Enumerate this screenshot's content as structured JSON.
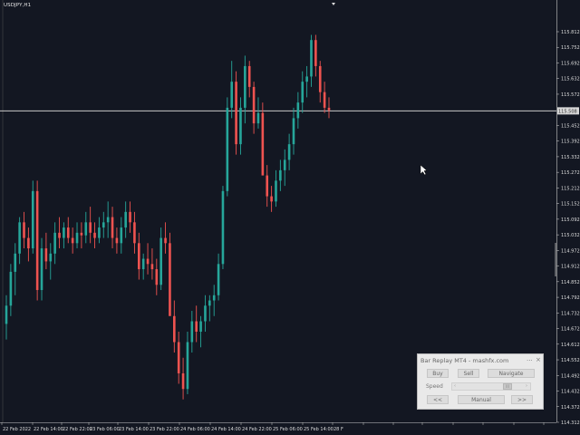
{
  "symbol_label": "USDJPY,H1",
  "colors": {
    "background": "#131722",
    "bull": "#26a69a",
    "bear": "#ef5350",
    "axis_text": "#dddddd",
    "price_line": "#c8c8c8"
  },
  "chart_data": {
    "type": "candlestick",
    "title": "",
    "ylim": [
      114.35,
      115.85
    ],
    "y_ticks": [
      "115.812",
      "115.752",
      "115.692",
      "115.632",
      "115.572",
      "115.452",
      "115.392",
      "115.332",
      "115.272",
      "115.212",
      "115.152",
      "115.092",
      "115.032",
      "114.972",
      "114.912",
      "114.852",
      "114.792",
      "114.732",
      "114.672",
      "114.612",
      "114.552",
      "114.492",
      "114.432",
      "114.372",
      "114.312"
    ],
    "current_price": 115.508,
    "current_price_label": "115.508",
    "x_labels": [
      "22 Feb 2022",
      "22 Feb 14:00",
      "22 Feb 22:00",
      "23 Feb 06:00",
      "23 Feb 14:00",
      "23 Feb 22:00",
      "24 Feb 06:00",
      "24 Feb 14:00",
      "24 Feb 22:00",
      "25 Feb 06:00",
      "25 Feb 14:00",
      "28 F"
    ],
    "candles": [
      [
        114.69,
        114.8,
        114.63,
        114.76
      ],
      [
        114.76,
        114.92,
        114.72,
        114.89
      ],
      [
        114.89,
        115.0,
        114.8,
        114.96
      ],
      [
        114.96,
        115.1,
        114.92,
        115.08
      ],
      [
        115.08,
        115.12,
        114.98,
        115.02
      ],
      [
        115.02,
        115.06,
        114.93,
        114.98
      ],
      [
        114.98,
        115.24,
        114.96,
        115.2
      ],
      [
        115.2,
        115.24,
        114.78,
        114.82
      ],
      [
        114.82,
        115.02,
        114.78,
        114.98
      ],
      [
        114.98,
        115.04,
        114.9,
        114.93
      ],
      [
        114.93,
        115.0,
        114.86,
        114.96
      ],
      [
        114.96,
        115.08,
        114.92,
        115.04
      ],
      [
        115.04,
        115.1,
        114.98,
        115.02
      ],
      [
        115.02,
        115.08,
        114.98,
        115.06
      ],
      [
        115.06,
        115.1,
        115.0,
        115.02
      ],
      [
        115.02,
        115.06,
        114.96,
        115.0
      ],
      [
        115.0,
        115.08,
        114.98,
        115.04
      ],
      [
        115.04,
        115.08,
        114.98,
        115.03
      ],
      [
        115.03,
        115.12,
        115.0,
        115.08
      ],
      [
        115.08,
        115.14,
        115.0,
        115.04
      ],
      [
        115.04,
        115.08,
        114.98,
        115.02
      ],
      [
        115.02,
        115.1,
        115.0,
        115.06
      ],
      [
        115.06,
        115.12,
        115.02,
        115.08
      ],
      [
        115.08,
        115.16,
        115.02,
        115.1
      ],
      [
        115.1,
        115.14,
        114.98,
        115.02
      ],
      [
        115.02,
        115.06,
        114.96,
        115.0
      ],
      [
        115.0,
        115.1,
        114.96,
        115.06
      ],
      [
        115.06,
        115.16,
        115.02,
        115.12
      ],
      [
        115.12,
        115.16,
        115.04,
        115.08
      ],
      [
        115.08,
        115.12,
        114.96,
        115.0
      ],
      [
        115.0,
        115.04,
        114.86,
        114.9
      ],
      [
        114.9,
        114.96,
        114.86,
        114.94
      ],
      [
        114.94,
        115.0,
        114.88,
        114.92
      ],
      [
        114.92,
        114.98,
        114.86,
        114.9
      ],
      [
        114.9,
        114.94,
        114.8,
        114.84
      ],
      [
        114.84,
        115.06,
        114.82,
        115.02
      ],
      [
        115.02,
        115.08,
        114.96,
        115.0
      ],
      [
        115.0,
        115.04,
        114.8,
        114.72
      ],
      [
        114.72,
        114.78,
        114.58,
        114.62
      ],
      [
        114.62,
        114.66,
        114.46,
        114.5
      ],
      [
        114.5,
        114.56,
        114.4,
        114.44
      ],
      [
        114.44,
        114.66,
        114.42,
        114.62
      ],
      [
        114.62,
        114.74,
        114.58,
        114.7
      ],
      [
        114.7,
        114.76,
        114.62,
        114.66
      ],
      [
        114.66,
        114.72,
        114.6,
        114.7
      ],
      [
        114.7,
        114.8,
        114.66,
        114.76
      ],
      [
        114.76,
        114.8,
        114.7,
        114.78
      ],
      [
        114.78,
        114.84,
        114.72,
        114.8
      ],
      [
        114.8,
        114.96,
        114.78,
        114.92
      ],
      [
        114.92,
        115.22,
        114.9,
        115.2
      ],
      [
        115.2,
        115.56,
        115.18,
        115.52
      ],
      [
        115.52,
        115.7,
        115.48,
        115.62
      ],
      [
        115.62,
        115.66,
        115.34,
        115.38
      ],
      [
        115.38,
        115.56,
        115.34,
        115.52
      ],
      [
        115.52,
        115.72,
        115.46,
        115.68
      ],
      [
        115.68,
        115.7,
        115.56,
        115.6
      ],
      [
        115.6,
        115.62,
        115.42,
        115.46
      ],
      [
        115.46,
        115.56,
        115.44,
        115.5
      ],
      [
        115.5,
        115.54,
        115.3,
        115.26
      ],
      [
        115.26,
        115.3,
        115.14,
        115.18
      ],
      [
        115.18,
        115.22,
        115.12,
        115.16
      ],
      [
        115.16,
        115.28,
        115.14,
        115.24
      ],
      [
        115.24,
        115.32,
        115.2,
        115.28
      ],
      [
        115.28,
        115.36,
        115.22,
        115.32
      ],
      [
        115.32,
        115.42,
        115.28,
        115.38
      ],
      [
        115.38,
        115.52,
        115.34,
        115.48
      ],
      [
        115.48,
        115.58,
        115.44,
        115.54
      ],
      [
        115.54,
        115.66,
        115.5,
        115.62
      ],
      [
        115.62,
        115.68,
        115.56,
        115.64
      ],
      [
        115.64,
        115.8,
        115.6,
        115.78
      ],
      [
        115.78,
        115.8,
        115.64,
        115.68
      ],
      [
        115.68,
        115.7,
        115.54,
        115.58
      ],
      [
        115.58,
        115.62,
        115.5,
        115.52
      ],
      [
        115.52,
        115.56,
        115.48,
        115.51
      ]
    ]
  },
  "replay_panel": {
    "title": "Bar Replay MT4 - mashfx.com",
    "dots": "...",
    "close": "×",
    "buy": "Buy",
    "sell": "Sell",
    "navigate": "Navigate",
    "speed_label": "Speed",
    "slider_left": "‹",
    "slider_right": "›",
    "slider_thumb": "III",
    "back": "<<",
    "manual": "Manual",
    "forward": ">>"
  },
  "cursor_icon": "arrow-pointer-icon"
}
